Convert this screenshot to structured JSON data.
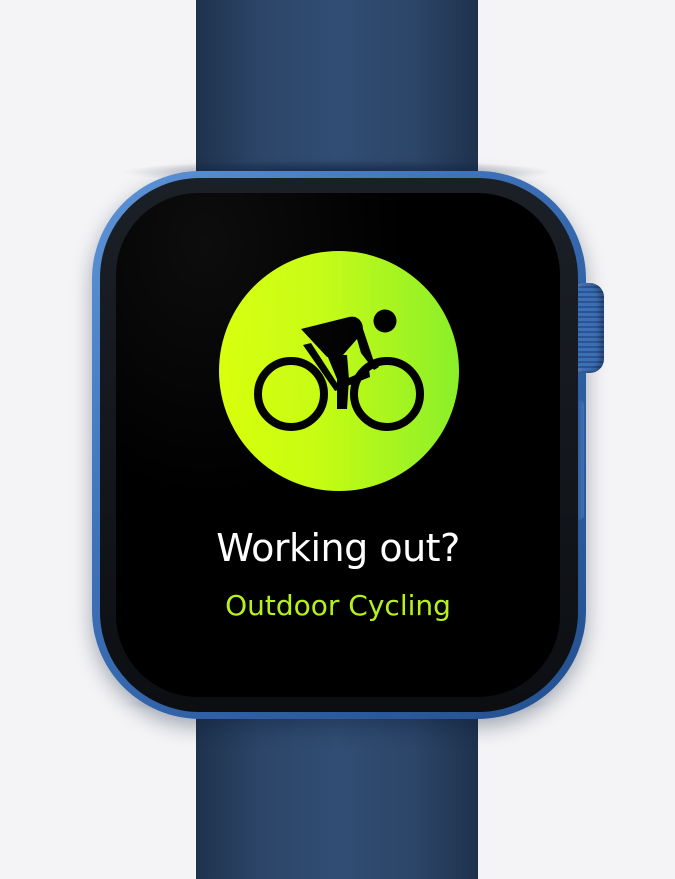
{
  "workout_prompt": {
    "icon": "outdoor-cycling-icon",
    "title": "Working out?",
    "workout_type": "Outdoor Cycling",
    "accent_color": "#b6f21a"
  },
  "device": {
    "band_color": "#2c4568",
    "case_color": "#3f73ba"
  }
}
